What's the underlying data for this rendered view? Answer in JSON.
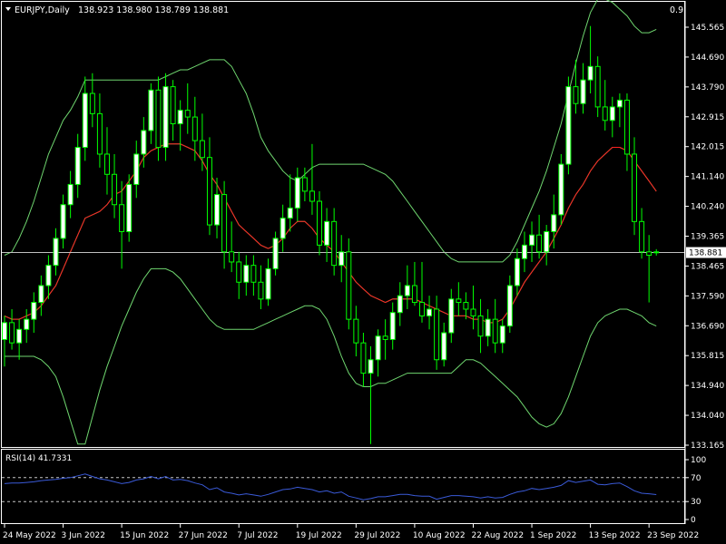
{
  "header": {
    "symbol": "EURJPY,Daily",
    "ohlc": "138.923 138.980 138.789 138.881",
    "corner_value": "0.9"
  },
  "rsi_panel": {
    "label": "RSI(14) 41.7331",
    "levels": [
      70,
      30
    ],
    "ticks": [
      "100",
      "70",
      "30",
      "0"
    ]
  },
  "colors": {
    "background": "#000000",
    "bull_candle": "#ffffff",
    "bear_candle": "#000000",
    "candle_outline": "#00ff00",
    "bands": "#6fd66f",
    "middle_ma": "#ff2020",
    "rsi_line": "#3a5ad8",
    "price_line": "#c0c0c0",
    "text": "#ffffff"
  },
  "chart_data": {
    "type": "candlestick",
    "price_axis_ticks": [
      "145.565",
      "144.690",
      "143.790",
      "142.915",
      "142.015",
      "141.140",
      "140.240",
      "139.365",
      "138.465",
      "137.590",
      "136.690",
      "135.815",
      "134.940",
      "134.040",
      "133.165"
    ],
    "price_axis_range": [
      133.165,
      145.565
    ],
    "current_price_label": "138.881",
    "x_axis_labels": [
      "24 May 2022",
      "3 Jun 2022",
      "15 Jun 2022",
      "27 Jun 2022",
      "7 Jul 2022",
      "19 Jul 2022",
      "29 Jul 2022",
      "10 Aug 2022",
      "22 Aug 2022",
      "1 Sep 2022",
      "13 Sep 2022",
      "23 Sep 2022"
    ],
    "candles": [
      {
        "o": 136.3,
        "h": 137.0,
        "l": 135.5,
        "c": 136.8
      },
      {
        "o": 136.8,
        "h": 137.2,
        "l": 136.0,
        "c": 136.2
      },
      {
        "o": 136.2,
        "h": 136.9,
        "l": 135.7,
        "c": 136.6
      },
      {
        "o": 136.6,
        "h": 137.2,
        "l": 136.2,
        "c": 136.9
      },
      {
        "o": 136.9,
        "h": 137.7,
        "l": 136.5,
        "c": 137.4
      },
      {
        "o": 137.4,
        "h": 138.2,
        "l": 137.0,
        "c": 137.9
      },
      {
        "o": 137.9,
        "h": 138.8,
        "l": 137.5,
        "c": 138.5
      },
      {
        "o": 138.5,
        "h": 139.6,
        "l": 138.2,
        "c": 139.3
      },
      {
        "o": 139.3,
        "h": 140.6,
        "l": 139.0,
        "c": 140.3
      },
      {
        "o": 140.3,
        "h": 141.3,
        "l": 139.9,
        "c": 140.9
      },
      {
        "o": 140.9,
        "h": 142.4,
        "l": 140.5,
        "c": 142.0
      },
      {
        "o": 142.0,
        "h": 144.1,
        "l": 141.6,
        "c": 143.6
      },
      {
        "o": 143.6,
        "h": 144.2,
        "l": 142.6,
        "c": 143.0
      },
      {
        "o": 143.0,
        "h": 143.6,
        "l": 141.4,
        "c": 141.8
      },
      {
        "o": 141.8,
        "h": 142.6,
        "l": 140.6,
        "c": 141.2
      },
      {
        "o": 141.2,
        "h": 141.8,
        "l": 139.9,
        "c": 140.3
      },
      {
        "o": 140.3,
        "h": 141.0,
        "l": 138.4,
        "c": 139.5
      },
      {
        "o": 139.5,
        "h": 141.2,
        "l": 139.2,
        "c": 140.9
      },
      {
        "o": 140.9,
        "h": 142.2,
        "l": 140.5,
        "c": 141.8
      },
      {
        "o": 141.8,
        "h": 142.9,
        "l": 141.4,
        "c": 142.5
      },
      {
        "o": 142.5,
        "h": 143.9,
        "l": 142.1,
        "c": 143.7
      },
      {
        "o": 143.7,
        "h": 144.1,
        "l": 141.6,
        "c": 142.0
      },
      {
        "o": 142.0,
        "h": 144.2,
        "l": 141.6,
        "c": 143.8
      },
      {
        "o": 143.8,
        "h": 144.0,
        "l": 142.2,
        "c": 142.7
      },
      {
        "o": 142.7,
        "h": 143.4,
        "l": 141.9,
        "c": 143.1
      },
      {
        "o": 143.1,
        "h": 143.9,
        "l": 142.4,
        "c": 142.9
      },
      {
        "o": 142.9,
        "h": 143.5,
        "l": 141.6,
        "c": 142.2
      },
      {
        "o": 142.2,
        "h": 143.0,
        "l": 141.3,
        "c": 141.7
      },
      {
        "o": 141.7,
        "h": 142.3,
        "l": 139.4,
        "c": 139.7
      },
      {
        "o": 139.7,
        "h": 141.1,
        "l": 139.3,
        "c": 140.6
      },
      {
        "o": 140.6,
        "h": 141.0,
        "l": 138.4,
        "c": 138.9
      },
      {
        "o": 138.9,
        "h": 139.8,
        "l": 138.3,
        "c": 138.6
      },
      {
        "o": 138.6,
        "h": 138.9,
        "l": 137.5,
        "c": 138.0
      },
      {
        "o": 138.0,
        "h": 138.8,
        "l": 137.6,
        "c": 138.5
      },
      {
        "o": 138.5,
        "h": 138.8,
        "l": 137.6,
        "c": 138.0
      },
      {
        "o": 138.0,
        "h": 138.5,
        "l": 137.2,
        "c": 137.5
      },
      {
        "o": 137.5,
        "h": 138.7,
        "l": 137.3,
        "c": 138.4
      },
      {
        "o": 138.4,
        "h": 139.5,
        "l": 138.2,
        "c": 139.3
      },
      {
        "o": 139.3,
        "h": 140.3,
        "l": 138.9,
        "c": 139.9
      },
      {
        "o": 139.9,
        "h": 141.2,
        "l": 139.5,
        "c": 140.2
      },
      {
        "o": 140.2,
        "h": 141.4,
        "l": 139.8,
        "c": 141.1
      },
      {
        "o": 141.1,
        "h": 141.4,
        "l": 140.4,
        "c": 140.7
      },
      {
        "o": 140.7,
        "h": 142.1,
        "l": 140.0,
        "c": 140.4
      },
      {
        "o": 140.4,
        "h": 140.7,
        "l": 138.8,
        "c": 139.1
      },
      {
        "o": 139.1,
        "h": 140.2,
        "l": 138.6,
        "c": 139.8
      },
      {
        "o": 139.8,
        "h": 140.2,
        "l": 138.2,
        "c": 138.5
      },
      {
        "o": 138.5,
        "h": 139.4,
        "l": 138.0,
        "c": 138.9
      },
      {
        "o": 138.9,
        "h": 139.3,
        "l": 136.6,
        "c": 136.9
      },
      {
        "o": 136.9,
        "h": 137.3,
        "l": 135.8,
        "c": 136.2
      },
      {
        "o": 136.2,
        "h": 136.5,
        "l": 134.9,
        "c": 135.3
      },
      {
        "o": 135.3,
        "h": 136.1,
        "l": 133.2,
        "c": 135.7
      },
      {
        "o": 135.7,
        "h": 136.6,
        "l": 135.2,
        "c": 136.4
      },
      {
        "o": 136.4,
        "h": 136.9,
        "l": 135.7,
        "c": 136.3
      },
      {
        "o": 136.3,
        "h": 137.4,
        "l": 136.0,
        "c": 137.1
      },
      {
        "o": 137.1,
        "h": 138.0,
        "l": 136.7,
        "c": 137.6
      },
      {
        "o": 137.6,
        "h": 138.5,
        "l": 137.2,
        "c": 137.9
      },
      {
        "o": 137.9,
        "h": 138.6,
        "l": 137.3,
        "c": 137.4
      },
      {
        "o": 137.4,
        "h": 138.6,
        "l": 136.8,
        "c": 137.0
      },
      {
        "o": 137.0,
        "h": 137.6,
        "l": 136.6,
        "c": 137.2
      },
      {
        "o": 137.2,
        "h": 137.6,
        "l": 135.4,
        "c": 135.7
      },
      {
        "o": 135.7,
        "h": 136.8,
        "l": 135.5,
        "c": 136.5
      },
      {
        "o": 136.5,
        "h": 137.8,
        "l": 136.2,
        "c": 137.5
      },
      {
        "o": 137.5,
        "h": 138.0,
        "l": 137.0,
        "c": 137.4
      },
      {
        "o": 137.4,
        "h": 137.7,
        "l": 136.9,
        "c": 137.2
      },
      {
        "o": 137.2,
        "h": 137.9,
        "l": 136.6,
        "c": 137.0
      },
      {
        "o": 137.0,
        "h": 137.5,
        "l": 135.9,
        "c": 136.4
      },
      {
        "o": 136.4,
        "h": 137.2,
        "l": 136.1,
        "c": 136.9
      },
      {
        "o": 136.9,
        "h": 137.5,
        "l": 135.9,
        "c": 136.2
      },
      {
        "o": 136.2,
        "h": 136.9,
        "l": 135.9,
        "c": 136.7
      },
      {
        "o": 136.7,
        "h": 138.2,
        "l": 136.5,
        "c": 137.9
      },
      {
        "o": 137.9,
        "h": 139.0,
        "l": 137.6,
        "c": 138.7
      },
      {
        "o": 138.7,
        "h": 139.5,
        "l": 138.3,
        "c": 139.1
      },
      {
        "o": 139.1,
        "h": 139.8,
        "l": 138.6,
        "c": 139.4
      },
      {
        "o": 139.4,
        "h": 140.0,
        "l": 138.7,
        "c": 138.9
      },
      {
        "o": 138.9,
        "h": 139.7,
        "l": 138.5,
        "c": 139.5
      },
      {
        "o": 139.5,
        "h": 140.6,
        "l": 139.0,
        "c": 140.0
      },
      {
        "o": 140.0,
        "h": 141.8,
        "l": 139.7,
        "c": 141.5
      },
      {
        "o": 141.5,
        "h": 144.1,
        "l": 141.2,
        "c": 143.8
      },
      {
        "o": 143.8,
        "h": 144.6,
        "l": 143.0,
        "c": 143.3
      },
      {
        "o": 143.3,
        "h": 144.5,
        "l": 143.0,
        "c": 144.0
      },
      {
        "o": 144.0,
        "h": 145.6,
        "l": 143.6,
        "c": 144.4
      },
      {
        "o": 144.4,
        "h": 144.7,
        "l": 142.9,
        "c": 143.2
      },
      {
        "o": 143.2,
        "h": 144.0,
        "l": 142.5,
        "c": 142.8
      },
      {
        "o": 142.8,
        "h": 143.5,
        "l": 142.3,
        "c": 143.2
      },
      {
        "o": 143.2,
        "h": 143.6,
        "l": 142.6,
        "c": 143.4
      },
      {
        "o": 143.4,
        "h": 143.6,
        "l": 141.3,
        "c": 141.8
      },
      {
        "o": 141.8,
        "h": 142.3,
        "l": 139.4,
        "c": 139.8
      },
      {
        "o": 139.8,
        "h": 140.2,
        "l": 138.7,
        "c": 138.9
      },
      {
        "o": 138.9,
        "h": 139.4,
        "l": 137.4,
        "c": 138.8
      },
      {
        "o": 138.9,
        "h": 138.98,
        "l": 138.79,
        "c": 138.88
      }
    ],
    "ma20": [
      137.0,
      136.9,
      136.9,
      137.0,
      137.1,
      137.3,
      137.6,
      137.9,
      138.4,
      138.9,
      139.4,
      139.9,
      140.0,
      140.1,
      140.3,
      140.6,
      140.7,
      141.0,
      141.3,
      141.7,
      141.9,
      142.0,
      142.1,
      142.1,
      142.1,
      142.0,
      141.9,
      141.6,
      141.2,
      140.9,
      140.5,
      140.1,
      139.7,
      139.5,
      139.3,
      139.1,
      139.0,
      139.1,
      139.3,
      139.6,
      139.8,
      139.8,
      139.6,
      139.3,
      139.1,
      138.9,
      138.6,
      138.3,
      138.0,
      137.8,
      137.6,
      137.5,
      137.4,
      137.5,
      137.5,
      137.5,
      137.5,
      137.4,
      137.3,
      137.2,
      137.1,
      137.0,
      137.0,
      137.0,
      136.9,
      136.9,
      136.8,
      136.8,
      136.9,
      137.2,
      137.6,
      138.0,
      138.3,
      138.6,
      138.9,
      139.3,
      139.7,
      140.2,
      140.6,
      140.9,
      141.3,
      141.6,
      141.8,
      142.0,
      142.0,
      141.9,
      141.6,
      141.3,
      141.0,
      140.7
    ],
    "bb_upper": [
      138.8,
      138.9,
      139.3,
      139.8,
      140.4,
      141.1,
      141.8,
      142.3,
      142.8,
      143.1,
      143.5,
      144.0,
      144.0,
      144.0,
      144.0,
      144.0,
      144.0,
      144.0,
      144.0,
      144.0,
      144.0,
      144.0,
      144.1,
      144.2,
      144.3,
      144.3,
      144.4,
      144.5,
      144.6,
      144.6,
      144.6,
      144.4,
      144.0,
      143.6,
      143.0,
      142.3,
      141.9,
      141.6,
      141.3,
      141.1,
      141.0,
      141.2,
      141.4,
      141.5,
      141.5,
      141.5,
      141.5,
      141.5,
      141.5,
      141.5,
      141.4,
      141.3,
      141.2,
      141.0,
      140.7,
      140.4,
      140.1,
      139.8,
      139.5,
      139.2,
      138.9,
      138.7,
      138.6,
      138.6,
      138.6,
      138.6,
      138.6,
      138.6,
      138.6,
      138.8,
      139.2,
      139.7,
      140.2,
      140.7,
      141.3,
      142.0,
      142.7,
      143.6,
      144.5,
      145.3,
      146.0,
      146.4,
      146.4,
      146.3,
      146.1,
      145.9,
      145.6,
      145.4,
      145.4,
      145.5
    ],
    "bb_lower": [
      135.8,
      135.8,
      135.8,
      135.8,
      135.8,
      135.7,
      135.5,
      135.2,
      134.6,
      133.9,
      133.2,
      133.2,
      134.0,
      134.8,
      135.5,
      136.1,
      136.7,
      137.2,
      137.7,
      138.1,
      138.4,
      138.4,
      138.4,
      138.3,
      138.1,
      137.8,
      137.5,
      137.2,
      136.9,
      136.7,
      136.6,
      136.6,
      136.6,
      136.6,
      136.6,
      136.7,
      136.8,
      136.9,
      137.0,
      137.1,
      137.2,
      137.3,
      137.3,
      137.2,
      136.9,
      136.4,
      135.8,
      135.3,
      135.0,
      134.9,
      134.9,
      135.0,
      135.0,
      135.1,
      135.2,
      135.3,
      135.3,
      135.3,
      135.3,
      135.3,
      135.3,
      135.3,
      135.5,
      135.7,
      135.7,
      135.6,
      135.4,
      135.2,
      135.0,
      134.8,
      134.6,
      134.3,
      134.0,
      133.8,
      133.7,
      133.8,
      134.1,
      134.6,
      135.2,
      135.8,
      136.4,
      136.8,
      137.0,
      137.1,
      137.2,
      137.2,
      137.1,
      137.0,
      136.8,
      136.7
    ],
    "rsi": [
      60,
      61,
      61,
      62,
      63,
      65,
      66,
      67,
      69,
      70,
      73,
      76,
      72,
      68,
      66,
      63,
      60,
      62,
      66,
      68,
      72,
      68,
      72,
      66,
      67,
      65,
      61,
      58,
      50,
      53,
      46,
      44,
      41,
      43,
      41,
      39,
      42,
      46,
      50,
      51,
      54,
      52,
      50,
      46,
      48,
      44,
      46,
      39,
      36,
      33,
      35,
      38,
      38,
      40,
      42,
      42,
      40,
      39,
      39,
      34,
      37,
      40,
      40,
      39,
      38,
      36,
      38,
      36,
      37,
      42,
      46,
      48,
      52,
      50,
      52,
      54,
      57,
      65,
      62,
      64,
      66,
      59,
      58,
      60,
      61,
      55,
      48,
      44,
      43,
      41.7
    ]
  }
}
